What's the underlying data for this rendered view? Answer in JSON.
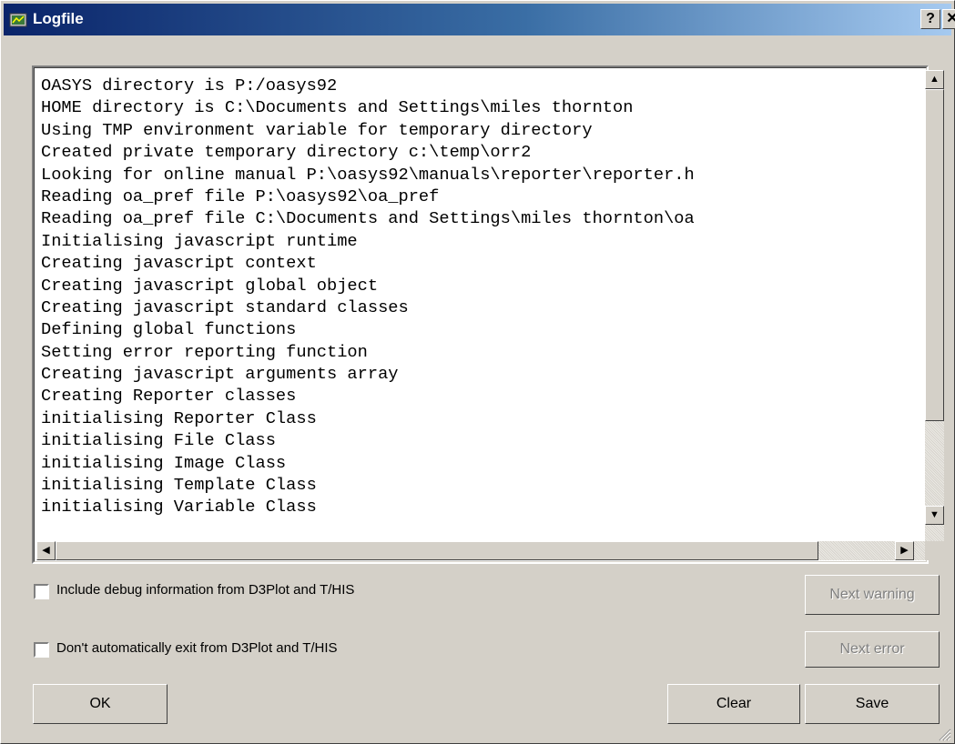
{
  "window": {
    "title": "Logfile",
    "help_label": "?",
    "close_label": "✕"
  },
  "log_lines": [
    "OASYS directory is P:/oasys92",
    "HOME directory is C:\\Documents and Settings\\miles thornton",
    "Using TMP environment variable for temporary directory",
    "Created private temporary directory c:\\temp\\orr2",
    "Looking for online manual P:\\oasys92\\manuals\\reporter\\reporter.h",
    "Reading oa_pref file P:\\oasys92\\oa_pref",
    "Reading oa_pref file C:\\Documents and Settings\\miles thornton\\oa",
    "Initialising javascript runtime",
    "Creating javascript context",
    "Creating javascript global object",
    "Creating javascript standard classes",
    "Defining global functions",
    "Setting error reporting function",
    "Creating javascript arguments array",
    "Creating Reporter classes",
    "initialising Reporter Class",
    "initialising File Class",
    "initialising Image Class",
    "initialising Template Class",
    "initialising Variable Class"
  ],
  "options": {
    "debug_label": "Include debug information from D3Plot and T/HIS",
    "debug_checked": false,
    "noexit_label": "Don't automatically exit from D3Plot and T/HIS",
    "noexit_checked": false
  },
  "buttons": {
    "next_warning": "Next warning",
    "next_error": "Next error",
    "ok": "OK",
    "clear": "Clear",
    "save": "Save"
  }
}
